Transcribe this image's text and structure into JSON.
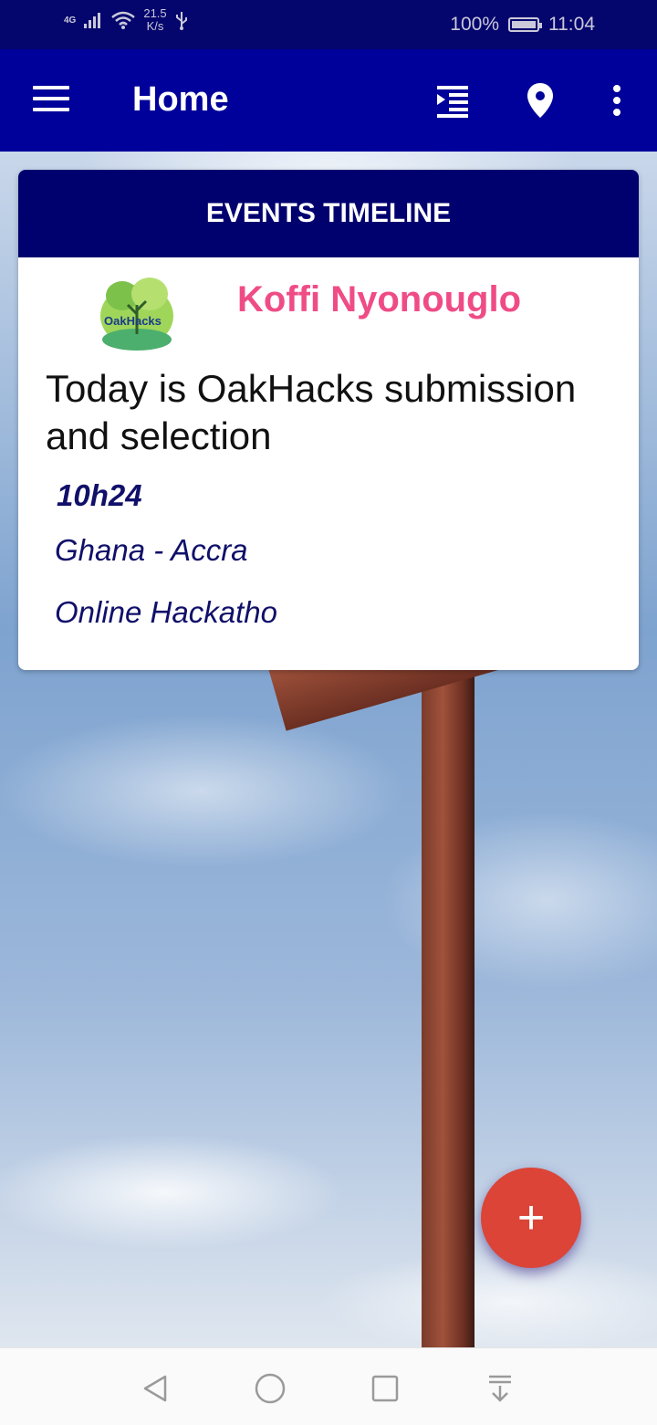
{
  "status_bar": {
    "network": "4G",
    "speed_value": "21.5",
    "speed_unit": "K/s",
    "battery": "100%",
    "time": "11:04"
  },
  "app_bar": {
    "title": "Home",
    "icons": [
      "menu-icon",
      "format-indent-icon",
      "location-pin-icon",
      "more-vert-icon"
    ]
  },
  "card": {
    "header": "EVENTS TIMELINE",
    "logo_text": "OakHacks",
    "author": "Koffi Nyonouglo",
    "event_text": "Today is OakHacks submission and selection",
    "time": "10h24",
    "location": "Ghana - Accra",
    "type": "Online Hackatho"
  },
  "fab": {
    "label": "+",
    "icon": "add-icon"
  },
  "nav_bar": {
    "icons": [
      "back-icon",
      "home-icon",
      "recents-icon",
      "notification-pull-icon"
    ]
  },
  "colors": {
    "status_bar": "#05056e",
    "app_bar": "#00009a",
    "card_header": "#00006e",
    "author": "#ef4c86",
    "event_details": "#10106a",
    "fab": "#db4437"
  }
}
